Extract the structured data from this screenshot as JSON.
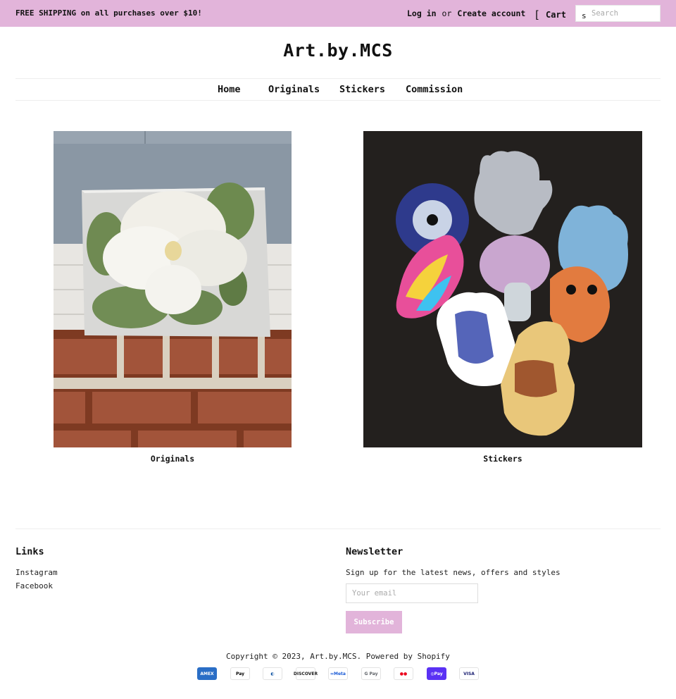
{
  "announcement": {
    "promo": "FREE SHIPPING on all purchases over $10!",
    "login": "Log in",
    "or": "or",
    "create_account": "Create account",
    "cart": "Cart",
    "search_placeholder": "Search"
  },
  "header": {
    "logo": "Art.by.MCS",
    "nav": [
      "Home",
      "Originals",
      "Stickers",
      "Commission"
    ]
  },
  "collections": [
    {
      "title": "Originals",
      "image": "magnolia-painting"
    },
    {
      "title": "Stickers",
      "image": "sticker-collage"
    }
  ],
  "footer": {
    "links_heading": "Links",
    "links": [
      "Instagram",
      "Facebook"
    ],
    "newsletter_heading": "Newsletter",
    "newsletter_text": "Sign up for the latest news, offers and styles",
    "email_placeholder": "Your email",
    "subscribe": "Subscribe",
    "copyright": "Copyright © 2023, Art.by.MCS. Powered by Shopify",
    "payments": [
      {
        "name": "amex",
        "label": "AMEX",
        "bg": "#2a6ec6",
        "fg": "#ffffff"
      },
      {
        "name": "apple-pay",
        "label": " Pay",
        "bg": "#ffffff",
        "fg": "#000000"
      },
      {
        "name": "diners",
        "label": "◐",
        "bg": "#ffffff",
        "fg": "#1d5ea8"
      },
      {
        "name": "discover",
        "label": "DISCOVER",
        "bg": "#ffffff",
        "fg": "#222222"
      },
      {
        "name": "meta-pay",
        "label": "∞Meta",
        "bg": "#ffffff",
        "fg": "#1a5ad6"
      },
      {
        "name": "google-pay",
        "label": "G Pay",
        "bg": "#ffffff",
        "fg": "#5f6368"
      },
      {
        "name": "mastercard",
        "label": "●●",
        "bg": "#ffffff",
        "fg": "#eb001b"
      },
      {
        "name": "shop-pay",
        "label": "◎Pay",
        "bg": "#5a31f4",
        "fg": "#ffffff"
      },
      {
        "name": "visa",
        "label": "VISA",
        "bg": "#ffffff",
        "fg": "#1a1f71"
      }
    ]
  },
  "colors": {
    "accent": "#e2b4da"
  }
}
